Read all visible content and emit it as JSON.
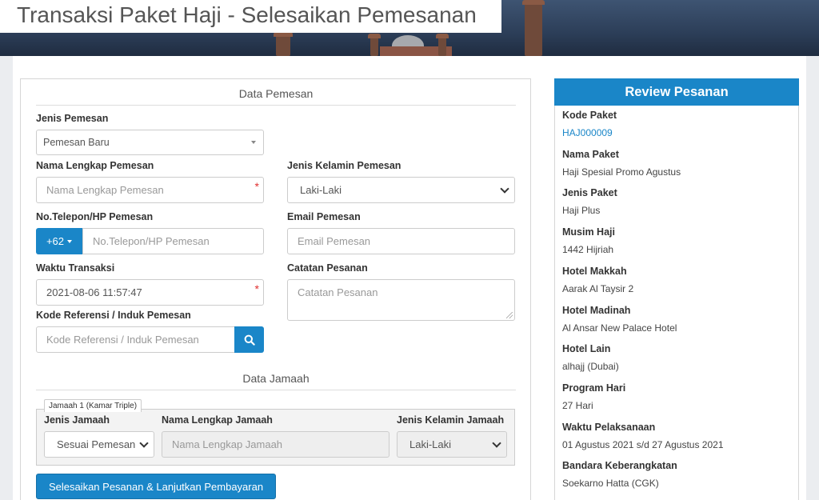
{
  "page_title": "Transaksi Paket Haji - Selesaikan Pemesanan",
  "form": {
    "section_pemesan": "Data Pemesan",
    "jenis_pemesan": {
      "label": "Jenis Pemesan",
      "value": "Pemesan Baru"
    },
    "nama_pemesan": {
      "label": "Nama Lengkap Pemesan",
      "placeholder": "Nama Lengkap Pemesan",
      "required_mark": "*"
    },
    "jenis_kelamin": {
      "label": "Jenis Kelamin Pemesan",
      "value": "Laki-Laki"
    },
    "telepon": {
      "label": "No.Telepon/HP Pemesan",
      "country_code": "+62",
      "placeholder": "No.Telepon/HP Pemesan"
    },
    "email": {
      "label": "Email Pemesan",
      "placeholder": "Email Pemesan"
    },
    "waktu": {
      "label": "Waktu Transaksi",
      "value": "2021-08-06 11:57:47",
      "required_mark": "*"
    },
    "catatan": {
      "label": "Catatan Pesanan",
      "placeholder": "Catatan Pesanan"
    },
    "referensi": {
      "label": "Kode Referensi / Induk Pemesan",
      "placeholder": "Kode Referensi / Induk Pemesan"
    },
    "section_jamaah": "Data Jamaah",
    "jamaah_legend": "Jamaah 1 (Kamar Triple)",
    "jenis_jamaah": {
      "label": "Jenis Jamaah",
      "value": "Sesuai Pemesan"
    },
    "nama_jamaah": {
      "label": "Nama Lengkap Jamaah",
      "placeholder": "Nama Lengkap Jamaah"
    },
    "kelamin_jamaah": {
      "label": "Jenis Kelamin Jamaah",
      "value": "Laki-Laki"
    },
    "submit_label": "Selesaikan Pesanan & Lanjutkan Pembayaran"
  },
  "review": {
    "title": "Review Pesanan",
    "items": [
      {
        "label": "Kode Paket",
        "value": "HAJ000009"
      },
      {
        "label": "Nama Paket",
        "value": "Haji Spesial Promo Agustus"
      },
      {
        "label": "Jenis Paket",
        "value": "Haji Plus"
      },
      {
        "label": "Musim Haji",
        "value": "1442 Hijriah"
      },
      {
        "label": "Hotel Makkah",
        "value": "Aarak Al Taysir 2"
      },
      {
        "label": "Hotel Madinah",
        "value": "Al Ansar New Palace Hotel"
      },
      {
        "label": "Hotel Lain",
        "value": "alhajj (Dubai)"
      },
      {
        "label": "Program Hari",
        "value": "27 Hari"
      },
      {
        "label": "Waktu Pelaksanaan",
        "value": "01 Agustus 2021 s/d 27 Agustus 2021"
      },
      {
        "label": "Bandara Keberangkatan",
        "value": "Soekarno Hatta (CGK)"
      }
    ]
  },
  "colors": {
    "primary": "#1a86c8",
    "required": "#e03030"
  },
  "icons": {
    "search": "search-icon",
    "dropdown": "chevron-down-icon"
  }
}
